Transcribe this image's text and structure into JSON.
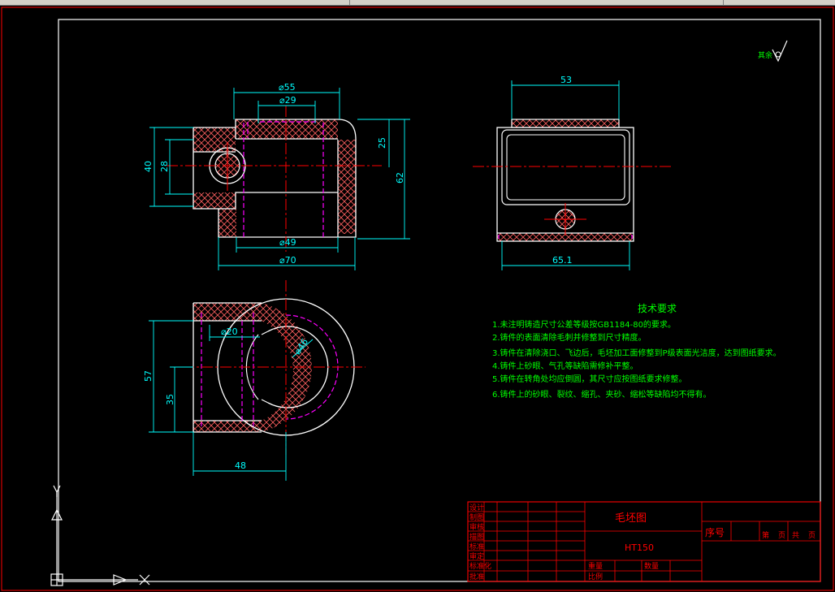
{
  "colors": {
    "background": "#000000",
    "outline": "#ffffff",
    "center_line": "#ff0000",
    "hidden_line": "#ff00ff",
    "dimension": "#00ffff",
    "notes": "#00ff00",
    "border": "#ff0000",
    "hatch": "#ff6060"
  },
  "dimensions": {
    "top_phi55": "⌀55",
    "top_phi29": "⌀29",
    "left_40": "40",
    "left_28": "28",
    "right_25": "25",
    "right_62": "62",
    "bottom_phi49": "⌀49",
    "bottom_phi70": "⌀70",
    "side_53": "53",
    "side_65_1": "65.1",
    "plan_phi20": "⌀20",
    "plan_phi46": "⌀46",
    "plan_57": "57",
    "plan_35": "35",
    "plan_48": "48"
  },
  "roughness_note": "其余",
  "tech_requirements": {
    "title": "技术要求",
    "items": [
      "1.未注明铸造尺寸公差等级按GB1184-80的要求。",
      "2.铸件的表面清除毛刺并修整到尺寸精度。",
      "3.铸件在清除浇口、飞边后，毛坯加工面修整到P级表面光洁度，达到图纸要求。",
      "4.铸件上砂眼、气孔等缺陷需修补平整。",
      "5.铸件在转角处均应倒圆，其尺寸应按图纸要求修整。",
      "6.铸件上的砂眼、裂纹、缩孔、夹砂、缩松等缺陷均不得有。"
    ]
  },
  "title_block": {
    "left_labels": [
      "设计",
      "制图",
      "审核",
      "描图",
      "标准",
      "审定",
      "标准化",
      "批准"
    ],
    "title": "毛坯图",
    "material": "HT150",
    "seq_label": "序号",
    "sheet_labels": [
      "第",
      "页",
      "共",
      "页"
    ],
    "weight_label": "重量",
    "ratio_label": "比例",
    "quantity_label": "数量"
  },
  "ucs": {
    "y_label": "Y",
    "x_label": "X"
  }
}
